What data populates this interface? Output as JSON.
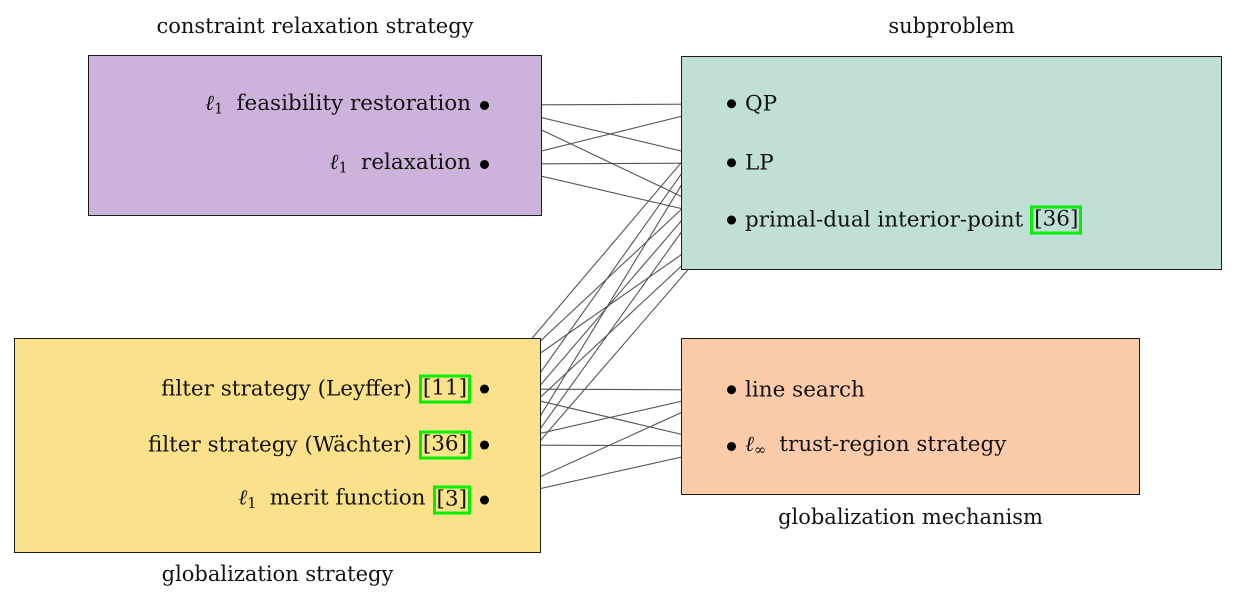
{
  "diagram": {
    "type": "bipartite-relationship-diagram",
    "background": "#ffffff",
    "edge_color": "#555555"
  },
  "groups": {
    "constraint_relaxation": {
      "caption": "constraint relaxation strategy",
      "caption_position": "above",
      "color": "#ccb3db",
      "border_color": "#1a1a1a",
      "items": [
        {
          "label_prefix": "ℓ",
          "label_sub": "1",
          "label_main": "feasibility restoration",
          "citation": null
        },
        {
          "label_prefix": "ℓ",
          "label_sub": "1",
          "label_main": "relaxation",
          "citation": null
        }
      ]
    },
    "subproblem": {
      "caption": "subproblem",
      "caption_position": "above",
      "color": "#bfdfd7",
      "border_color": "#1a1a1a",
      "items": [
        {
          "label_main": "QP",
          "citation": null
        },
        {
          "label_main": "LP",
          "citation": null
        },
        {
          "label_main": "primal-dual interior-point",
          "citation": "[36]"
        }
      ]
    },
    "globalization_strategy": {
      "caption": "globalization strategy",
      "caption_position": "below",
      "color": "#fbe189",
      "border_color": "#1a1a1a",
      "items": [
        {
          "label_main": "filter strategy (Leyffer)",
          "citation": "[11]"
        },
        {
          "label_main": "filter strategy (Wächter)",
          "citation": "[36]"
        },
        {
          "label_prefix": "ℓ",
          "label_sub": "1",
          "label_main": "merit function",
          "citation": "[3]"
        }
      ]
    },
    "globalization_mechanism": {
      "caption": "globalization mechanism",
      "caption_position": "below",
      "color": "#fcccaa",
      "border_color": "#1a1a1a",
      "items": [
        {
          "label_main": "line search",
          "citation": null
        },
        {
          "label_prefix": "ℓ",
          "label_sub": "∞",
          "label_main": "trust-region strategy",
          "citation": null
        }
      ]
    }
  },
  "citation_box_color": "#00f000",
  "edges": [
    {
      "from": "constraint_relaxation.0",
      "to": "subproblem.0"
    },
    {
      "from": "constraint_relaxation.0",
      "to": "subproblem.1"
    },
    {
      "from": "constraint_relaxation.0",
      "to": "subproblem.2"
    },
    {
      "from": "constraint_relaxation.1",
      "to": "subproblem.0"
    },
    {
      "from": "constraint_relaxation.1",
      "to": "subproblem.1"
    },
    {
      "from": "constraint_relaxation.1",
      "to": "subproblem.2"
    },
    {
      "from": "globalization_strategy.0",
      "to": "subproblem.0"
    },
    {
      "from": "globalization_strategy.0",
      "to": "subproblem.1"
    },
    {
      "from": "globalization_strategy.0",
      "to": "subproblem.2"
    },
    {
      "from": "globalization_strategy.1",
      "to": "subproblem.0"
    },
    {
      "from": "globalization_strategy.1",
      "to": "subproblem.1"
    },
    {
      "from": "globalization_strategy.1",
      "to": "subproblem.2"
    },
    {
      "from": "globalization_strategy.2",
      "to": "subproblem.0"
    },
    {
      "from": "globalization_strategy.2",
      "to": "subproblem.1"
    },
    {
      "from": "globalization_strategy.2",
      "to": "subproblem.2"
    },
    {
      "from": "globalization_strategy.0",
      "to": "globalization_mechanism.0"
    },
    {
      "from": "globalization_strategy.0",
      "to": "globalization_mechanism.1"
    },
    {
      "from": "globalization_strategy.1",
      "to": "globalization_mechanism.0"
    },
    {
      "from": "globalization_strategy.1",
      "to": "globalization_mechanism.1"
    },
    {
      "from": "globalization_strategy.2",
      "to": "globalization_mechanism.0"
    },
    {
      "from": "globalization_strategy.2",
      "to": "globalization_mechanism.1"
    }
  ]
}
